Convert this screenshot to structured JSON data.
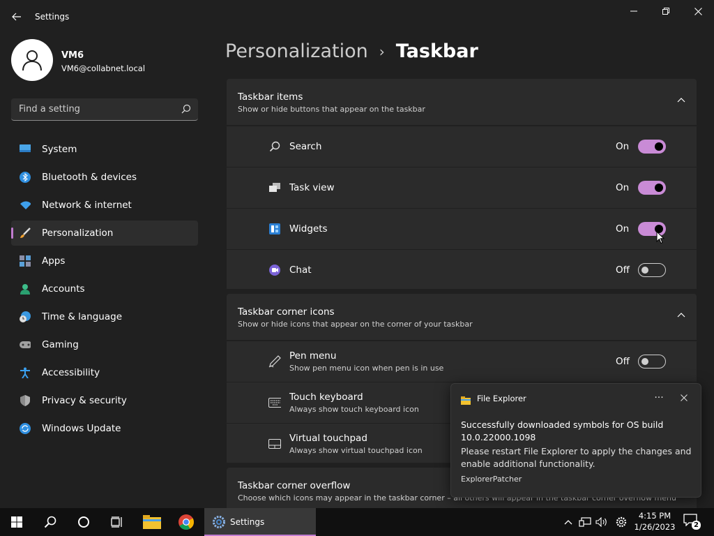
{
  "window": {
    "title": "Settings"
  },
  "profile": {
    "name": "VM6",
    "email": "VM6@collabnet.local"
  },
  "search": {
    "placeholder": "Find a setting"
  },
  "sidebar": {
    "items": [
      {
        "label": "System",
        "icon": "monitor-icon"
      },
      {
        "label": "Bluetooth & devices",
        "icon": "bluetooth-icon"
      },
      {
        "label": "Network & internet",
        "icon": "wifi-icon"
      },
      {
        "label": "Personalization",
        "icon": "brush-icon",
        "active": true
      },
      {
        "label": "Apps",
        "icon": "apps-icon"
      },
      {
        "label": "Accounts",
        "icon": "person-icon"
      },
      {
        "label": "Time & language",
        "icon": "clock-globe-icon"
      },
      {
        "label": "Gaming",
        "icon": "gamepad-icon"
      },
      {
        "label": "Accessibility",
        "icon": "accessibility-icon"
      },
      {
        "label": "Privacy & security",
        "icon": "shield-icon"
      },
      {
        "label": "Windows Update",
        "icon": "update-icon"
      }
    ]
  },
  "breadcrumb": {
    "parent": "Personalization",
    "separator": "›",
    "current": "Taskbar"
  },
  "sections": {
    "taskbar_items": {
      "title": "Taskbar items",
      "description": "Show or hide buttons that appear on the taskbar",
      "rows": [
        {
          "label": "Search",
          "state": "On",
          "on": true,
          "icon": "search-icon"
        },
        {
          "label": "Task view",
          "state": "On",
          "on": true,
          "icon": "task-view-icon"
        },
        {
          "label": "Widgets",
          "state": "On",
          "on": true,
          "icon": "widgets-icon"
        },
        {
          "label": "Chat",
          "state": "Off",
          "on": false,
          "icon": "chat-icon"
        }
      ]
    },
    "corner_icons": {
      "title": "Taskbar corner icons",
      "description": "Show or hide icons that appear on the corner of your taskbar",
      "rows": [
        {
          "label": "Pen menu",
          "sub": "Show pen menu icon when pen is in use",
          "state": "Off",
          "on": false,
          "icon": "pen-icon"
        },
        {
          "label": "Touch keyboard",
          "sub": "Always show touch keyboard icon",
          "icon": "keyboard-icon"
        },
        {
          "label": "Virtual touchpad",
          "sub": "Always show virtual touchpad icon",
          "icon": "touchpad-icon"
        }
      ]
    },
    "corner_overflow": {
      "title": "Taskbar corner overflow",
      "description": "Choose which icons may appear in the taskbar corner – all others will appear in the taskbar corner overflow menu"
    }
  },
  "notification": {
    "app": "File Explorer",
    "more": "···",
    "headline": "Successfully downloaded symbols for OS build 10.0.22000.1098",
    "body": "Please restart File Explorer to apply the changes and enable additional functionality.",
    "source": "ExplorerPatcher"
  },
  "taskbar": {
    "settings_label": "Settings",
    "time": "4:15 PM",
    "date": "1/26/2023",
    "notification_count": "2"
  },
  "colors": {
    "accent": "#c98bd6",
    "background": "#202020",
    "card": "#2b2b2b"
  }
}
